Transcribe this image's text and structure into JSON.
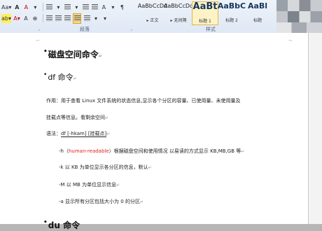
{
  "ribbon": {
    "row1": [
      "Aa▾",
      "A",
      "A",
      "▾",
      "≡",
      "▾",
      "≡",
      "▾",
      "≡",
      "≡",
      "A",
      "▾",
      "¶"
    ],
    "row2": [
      "ab▾",
      "A▾",
      "A",
      "⊕",
      "≡",
      "≡",
      "≡",
      "≡",
      "≡",
      "▾",
      "▾"
    ],
    "group_paragraph": "段落",
    "group_styles": "样式",
    "styles": [
      {
        "preview": "AaBbCcDd",
        "name": "▸ 正文",
        "kind": "normal",
        "active": false
      },
      {
        "preview": "AaBbCcDd",
        "name": "▸ 无间隔",
        "kind": "normal",
        "active": false
      },
      {
        "preview": "AaBt",
        "name": "标题 1",
        "kind": "large",
        "active": true
      },
      {
        "preview": "AaBbC",
        "name": "标题 2",
        "kind": "big",
        "active": false
      },
      {
        "preview": "AaBl",
        "name": "标题",
        "kind": "big",
        "active": false
      }
    ]
  },
  "doc": {
    "h1": "磁盘空间命令",
    "h2": "df 命令",
    "p1": "作用：用于查看 Linux 文件系统的状态信息,显示各个分区的容量、已使用量、未使用量及",
    "p2": "挂载点等信息。看剩余空间",
    "syntax_pre": "语法：",
    "syntax_cmd": "df [-hkam] [挂载点]",
    "opt_h_a": "-h（",
    "opt_h_red": "human-readable",
    "opt_h_b": "）根据磁盘空间和使用情况  以易读的方式显示  KB,MB,GB 等",
    "opt_k": "-k     以 KB 为单位显示各分区的信息，默认",
    "opt_M": "-M     以 MB 为单位显示信息",
    "opt_a": "-a     显示所有分区包括大小为 0   的分区",
    "h1b": "du 命令",
    "para_mark": "↵"
  }
}
